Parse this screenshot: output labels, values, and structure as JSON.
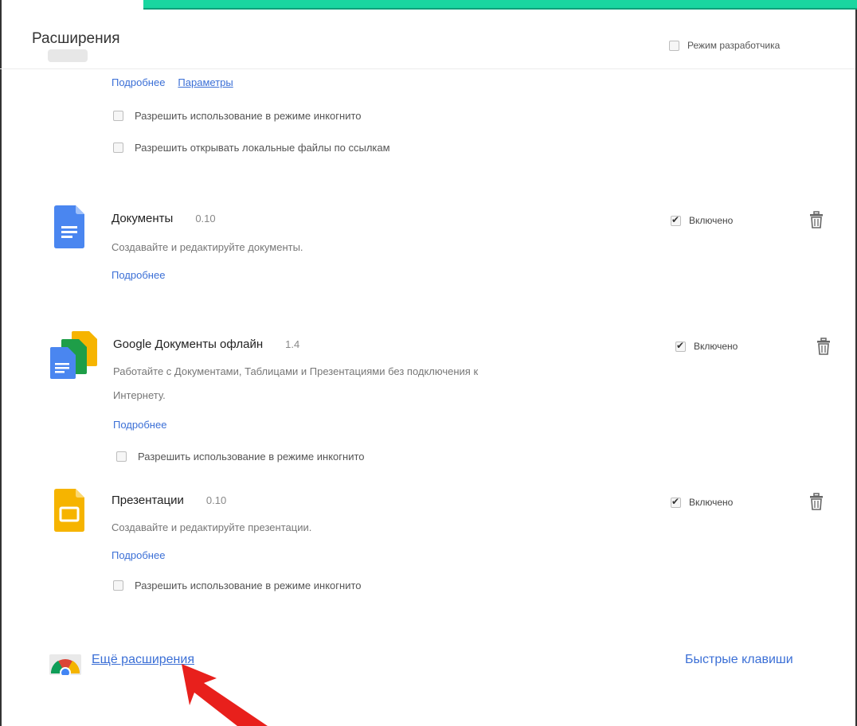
{
  "header": {
    "title": "Расширения",
    "dev_mode_label": "Режим разработчика"
  },
  "top_ext": {
    "details_link": "Подробнее",
    "params_link": "Параметры",
    "allow_incognito": "Разрешить использование в режиме инкогнито",
    "allow_local_files": "Разрешить открывать локальные файлы по ссылкам"
  },
  "extensions": [
    {
      "name": "Документы",
      "version": "0.10",
      "description": "Создавайте и редактируйте документы.",
      "details_link": "Подробнее",
      "enabled_label": "Включено",
      "enabled": true
    },
    {
      "name": "Google Документы офлайн",
      "version": "1.4",
      "description_line1": "Работайте с Документами, Таблицами и Презентациями без подключения к",
      "description_line2": "Интернету.",
      "details_link": "Подробнее",
      "enabled_label": "Включено",
      "enabled": true,
      "allow_incognito": "Разрешить использование в режиме инкогнито"
    },
    {
      "name": "Презентации",
      "version": "0.10",
      "description": "Создавайте и редактируйте презентации.",
      "details_link": "Подробнее",
      "enabled_label": "Включено",
      "enabled": true,
      "allow_incognito": "Разрешить использование в режиме инкогнито"
    }
  ],
  "footer": {
    "more_extensions": "Ещё расширения",
    "keyboard_shortcuts": "Быстрые клавиши"
  },
  "colors": {
    "link": "#3b6fd6",
    "docs_blue": "#4a86f0",
    "slides_yellow": "#f6b400",
    "arrow_red": "#e8201c",
    "accent_green": "#19d6a0"
  }
}
